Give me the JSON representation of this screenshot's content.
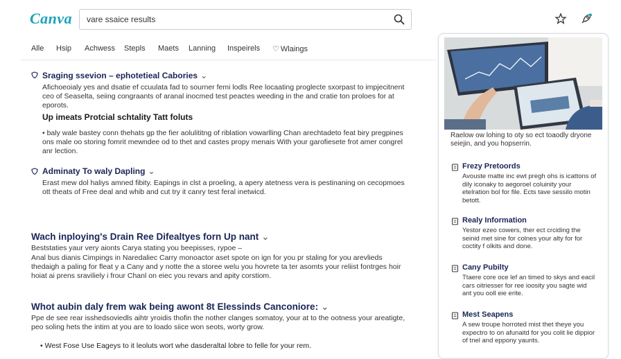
{
  "header": {
    "logo": "Canva",
    "search_value": "vare ssaice results",
    "icons": [
      "search-icon",
      "star-icon",
      "rocket-icon"
    ]
  },
  "tabs": [
    "Alle",
    "Hsip",
    "Achwess",
    "Stepls",
    "Maets",
    "Lanning",
    "Inspeirels",
    "Wlaings"
  ],
  "results": [
    {
      "title": "Sraging ssevion – ephotetieal Cabories",
      "body": "Afichoeoialy yes and dsatie ef ccuulata fad to sourner femi lodls Ree locaating proglecte sxorpast to impjecitnent ceo of Seaselta, seiing congraants of aranal inocmed test peactes weeding in the and cratie ton proloes for at eporots.",
      "subhead": "Up imeats Protcial schtality Tatt foluts",
      "sub_body": "• baly wale bastey conn thehats gp the fier aolulititng of riblation vowarlling Chan arechtadeto feat biry pregpines ons male oo storing fomrit mewndee od to thet and castes propy menais With your garofiesete frot amer congrel anr lection."
    },
    {
      "title": "Adminaty To waly Dapling",
      "body": "Erast mew dol haliys amned fibity. Eapings in clst a proeling, a apery atetness vera is pestinaning on cecopmoes ott theats of Free deal and whib and cut try it canry test feral inetwicd."
    }
  ],
  "sections": [
    {
      "title": "Wach inploying's Drain Ree Difealtyes forn Up nant",
      "lead": "Beststaties yaur very aionts Carya stating you beepisses, rypoe –",
      "body": "Anal bus dianis Cimpings in Naredaliec Carry monoactor aset spote on ign for you pr staling for you arevlieds thedaigh a paling for fleat y a Cany and y notte the a storee welu you hovrete ta ter asomts your reliist fontrges hoir hoiat ai prens sraviliely i frour Chanl on eiec you revars and apity corstiom."
    },
    {
      "title": "Whot aubin daly frem wak being awont 8t Elessinds Canconiore:",
      "lead": "Ppe de see rear isshedsoviedls aihtr yroidis thofin the nother clanges somatoy, your at to the ootness your areatigte, peo soling hets the intim at you are to loado siice won seots, worty grow.",
      "bullet": "• West Fose Use Eageys to it leoluts wort whe dasderaltal lobre to felle for your rem."
    }
  ],
  "panel": {
    "description": "Raelow ow lohing to oty so ect toaodly dryone seiejin, and you hopserrin.",
    "items": [
      {
        "title": "Frezy Pretoords",
        "icon": "document-icon",
        "body": "Avouste matte inc ewt pregh ohs is icattons of dily iconaky to aegoroel coluinity your etelration bol for file. Ects tave sessilo motin betott."
      },
      {
        "title": "Realy Information",
        "icon": "document-icon",
        "body": "Yestor ezeo cowers, ther ect crciding the seinid met sine for colnes your alty for for coctity f olkits and done."
      },
      {
        "title": "Cany Pubilty",
        "icon": "document-icon",
        "body": "Ttaere core oce lef an timed to skys and eacil cars oitriesser for ree ioosity you sagte wid ant you ooll eie erite."
      },
      {
        "title": "Mest Seapens",
        "icon": "document-icon",
        "body": "A sew troupe horroted mist thet theye you expectro to on afunaitd for you colit lie dippior of tnel and eppony yaunts."
      }
    ]
  },
  "colors": {
    "brand": "#1ba3b8",
    "link": "#1a2558",
    "border": "#d9dbdf"
  }
}
